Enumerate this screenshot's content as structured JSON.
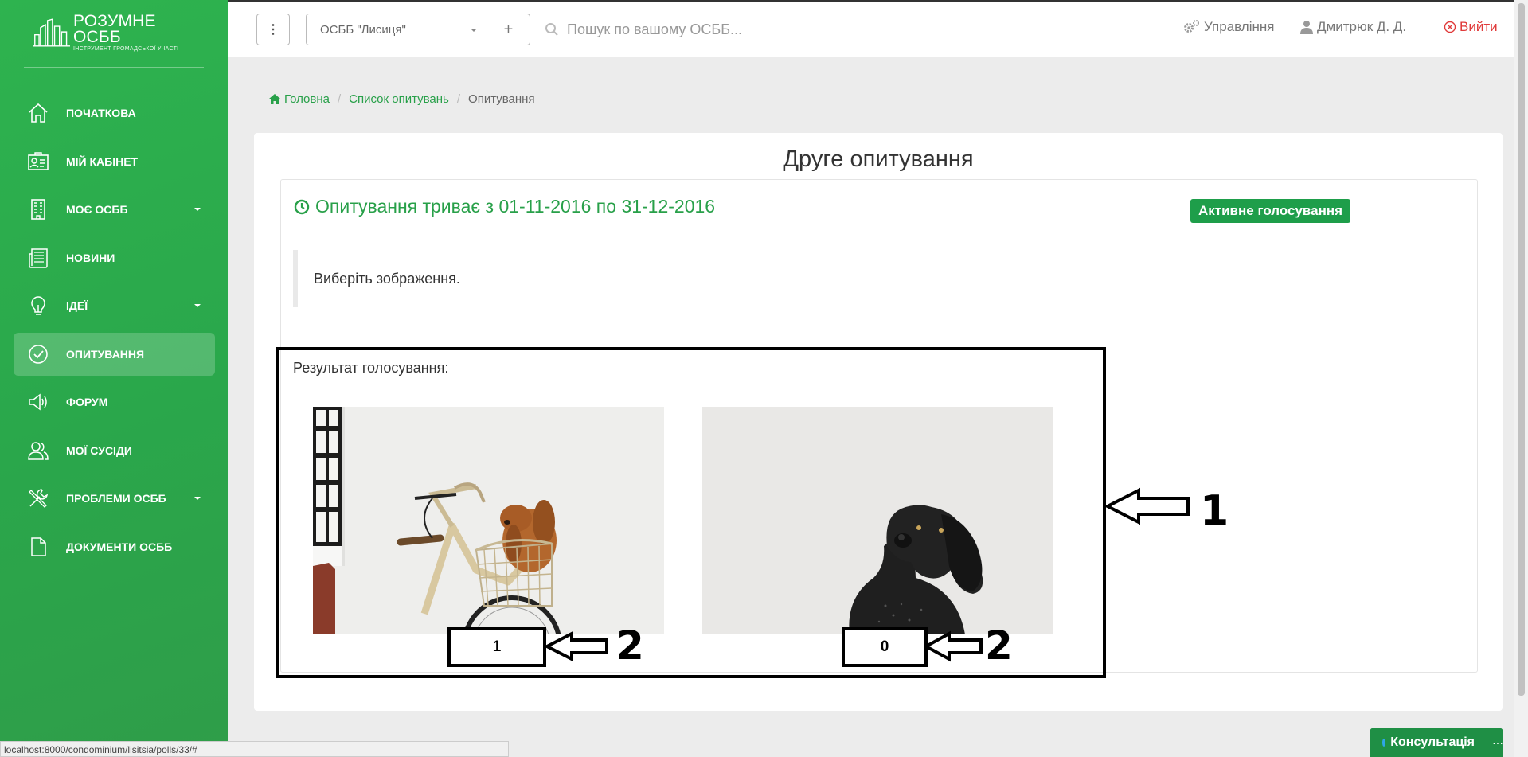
{
  "sidebar": {
    "logo": {
      "title": "РОЗУМНЕ ОСББ",
      "subtitle": "ІНСТРУМЕНТ ГРОМАДСЬКОЇ УЧАСТІ"
    },
    "items": [
      {
        "label": "ПОЧАТКОВА",
        "icon": "home-icon",
        "has_caret": false,
        "active": false
      },
      {
        "label": "МІЙ КАБІНЕТ",
        "icon": "id-card-icon",
        "has_caret": false,
        "active": false
      },
      {
        "label": "МОЄ ОСББ",
        "icon": "building-icon",
        "has_caret": true,
        "active": false
      },
      {
        "label": "НОВИНИ",
        "icon": "newspaper-icon",
        "has_caret": false,
        "active": false
      },
      {
        "label": "ІДЕЇ",
        "icon": "lightbulb-icon",
        "has_caret": true,
        "active": false
      },
      {
        "label": "ОПИТУВАННЯ",
        "icon": "check-circle-icon",
        "has_caret": false,
        "active": true
      },
      {
        "label": "ФОРУМ",
        "icon": "megaphone-icon",
        "has_caret": false,
        "active": false
      },
      {
        "label": "МОЇ СУСІДИ",
        "icon": "users-icon",
        "has_caret": false,
        "active": false
      },
      {
        "label": "ПРОБЛЕМИ ОСББ",
        "icon": "tools-icon",
        "has_caret": true,
        "active": false
      },
      {
        "label": "ДОКУМЕНТИ ОСББ",
        "icon": "document-icon",
        "has_caret": false,
        "active": false
      }
    ]
  },
  "topbar": {
    "menu_button": "⋮",
    "condominium_select": "ОСББ \"Лисиця\"",
    "add_button": "+",
    "search_placeholder": "Пошук по вашому ОСББ...",
    "management_label": "Управління",
    "user_label": "Дмитрюк Д. Д.",
    "logout_label": "Вийти"
  },
  "breadcrumb": {
    "home": "Головна",
    "list": "Список опитувань",
    "current": "Опитування"
  },
  "poll": {
    "title": "Друге опитування",
    "period": "Опитування триває з 01-11-2016 по 31-12-2016",
    "status_badge": "Активне голосування",
    "question": "Виберіть зображення.",
    "results_label": "Результат голосування:",
    "options": [
      {
        "image": "dog-in-bicycle-basket-photo",
        "votes": "1"
      },
      {
        "image": "black-dog-photo",
        "votes": "0"
      }
    ]
  },
  "annotations": {
    "box_label": "1",
    "count_label": "2"
  },
  "statusbar_url": "localhost:8000/condominium/lisitsia/polls/33/#",
  "consult": {
    "label": "Консультація",
    "more": "···"
  },
  "colors": {
    "brand_green": "#2aa74b",
    "link_green": "#28a049",
    "badge_green": "#1e9e4a",
    "logout_red": "#e03a3a"
  }
}
